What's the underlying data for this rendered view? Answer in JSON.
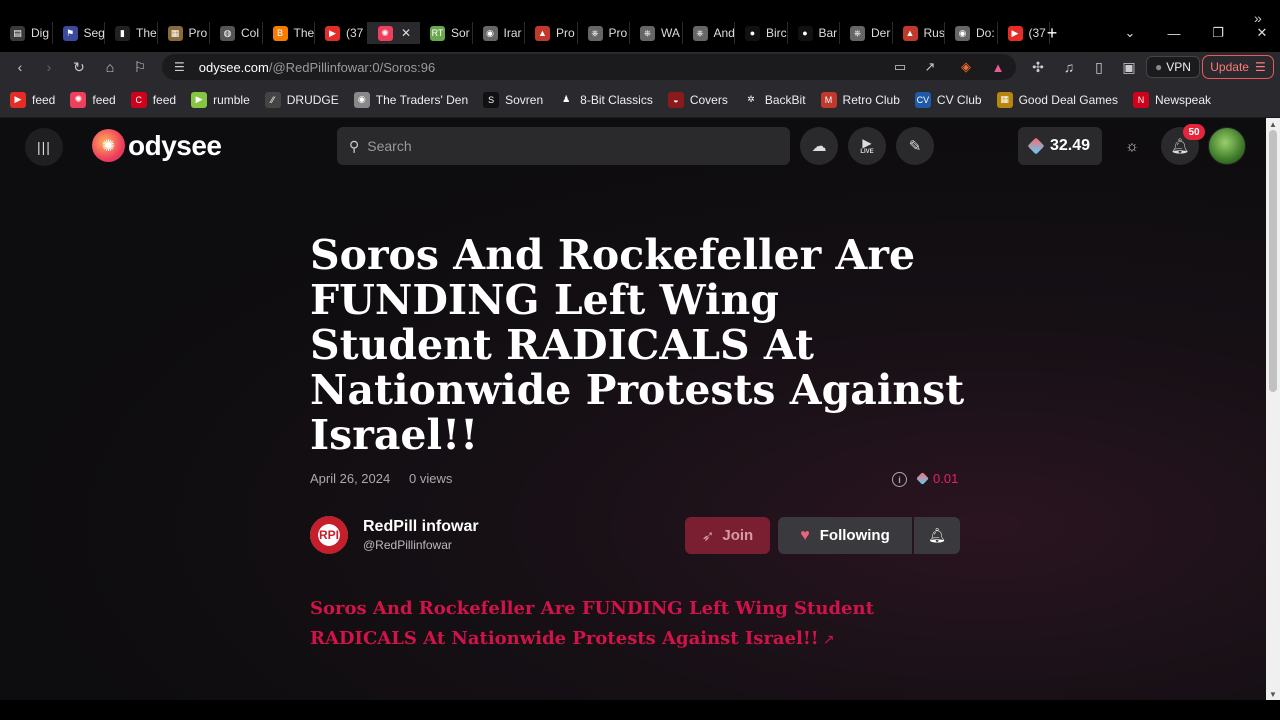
{
  "browser": {
    "tabs": [
      {
        "title": "Dig",
        "icon": "doc-icon",
        "color": "#3a3a3a"
      },
      {
        "title": "Seg",
        "icon": "flag-icon",
        "color": "#3b4a9e"
      },
      {
        "title": "The",
        "icon": "bookmark-icon",
        "color": "#222222"
      },
      {
        "title": "Pro",
        "icon": "art-icon",
        "color": "#8a6a3a"
      },
      {
        "title": "Col",
        "icon": "globe-icon",
        "color": "#555555"
      },
      {
        "title": "The",
        "icon": "blogger-icon",
        "color": "#f57c00"
      },
      {
        "title": "(37",
        "icon": "youtube-icon",
        "color": "#e52d27"
      },
      {
        "title": "",
        "icon": "odysee-icon",
        "color": "#ef3f5d",
        "active": true
      },
      {
        "title": "Sor",
        "icon": "rt-icon",
        "color": "#6aa84f"
      },
      {
        "title": "Irar",
        "icon": "profile-icon",
        "color": "#666666"
      },
      {
        "title": "Pro",
        "icon": "rocket-icon",
        "color": "#c0392b"
      },
      {
        "title": "Pro",
        "icon": "wheel-icon",
        "color": "#666666"
      },
      {
        "title": "WA",
        "icon": "wheel-icon",
        "color": "#666666"
      },
      {
        "title": "And",
        "icon": "wheel-icon",
        "color": "#666666"
      },
      {
        "title": "Birc",
        "icon": "circle-icon",
        "color": "#111111"
      },
      {
        "title": "Bar",
        "icon": "circle-icon",
        "color": "#111111"
      },
      {
        "title": "Der",
        "icon": "wheel-icon",
        "color": "#666666"
      },
      {
        "title": "Rus",
        "icon": "rocket-icon",
        "color": "#c0392b"
      },
      {
        "title": "Do:",
        "icon": "profile-icon",
        "color": "#666666"
      },
      {
        "title": "(37",
        "icon": "youtube-icon",
        "color": "#e52d27"
      }
    ],
    "url_host": "odysee.com",
    "url_path": "/@RedPillinfowar:0/Soros:96",
    "vpn_label": "VPN",
    "update_label": "Update",
    "bookmarks": [
      {
        "label": "feed",
        "color": "#e52d27",
        "icon": "youtube-icon"
      },
      {
        "label": "feed",
        "color": "#ef3f5d",
        "icon": "odysee-icon"
      },
      {
        "label": "feed",
        "color": "#d0021b",
        "icon": "c-icon"
      },
      {
        "label": "rumble",
        "color": "#85c742",
        "icon": "rumble-icon"
      },
      {
        "label": "DRUDGE",
        "color": "#444444",
        "icon": "drudge-icon"
      },
      {
        "label": "The Traders' Den",
        "color": "#888888",
        "icon": "coin-icon"
      },
      {
        "label": "Sovren",
        "color": "#111111",
        "icon": "s-icon"
      },
      {
        "label": "8-Bit Classics",
        "color": "#2a2a2e",
        "icon": "joystick-icon"
      },
      {
        "label": "Covers",
        "color": "#8b1a1a",
        "icon": "car-icon"
      },
      {
        "label": "BackBit",
        "color": "#2a2a2e",
        "icon": "b-icon"
      },
      {
        "label": "Retro Club",
        "color": "#c0392b",
        "icon": "m-icon"
      },
      {
        "label": "CV Club",
        "color": "#1e5aa8",
        "icon": "cv-icon"
      },
      {
        "label": "Good Deal Games",
        "color": "#b8860b",
        "icon": "gdg-icon"
      },
      {
        "label": "Newspeak",
        "color": "#d0021b",
        "icon": "n-icon"
      }
    ]
  },
  "header": {
    "logo_text": "odysee",
    "search_placeholder": "Search",
    "live_label": "LIVE",
    "credits": "32.49",
    "notification_count": "50"
  },
  "video": {
    "title": "Soros And Rockefeller Are FUNDING Left Wing Student RADICALS At Nationwide Protests Against Israel!!",
    "date": "April 26, 2024",
    "views": "0 views",
    "tip_amount": "0.01",
    "channel_name": "RedPill infowar",
    "channel_handle": "@RedPillinfowar",
    "channel_avatar_text": "RPI",
    "join_label": "Join",
    "following_label": "Following",
    "description_link": "Soros And Rockefeller Are FUNDING Left Wing Student RADICALS At Nationwide Protests Against Israel!!"
  },
  "colors": {
    "accent": "#d2134a",
    "badge": "#e5253c"
  }
}
